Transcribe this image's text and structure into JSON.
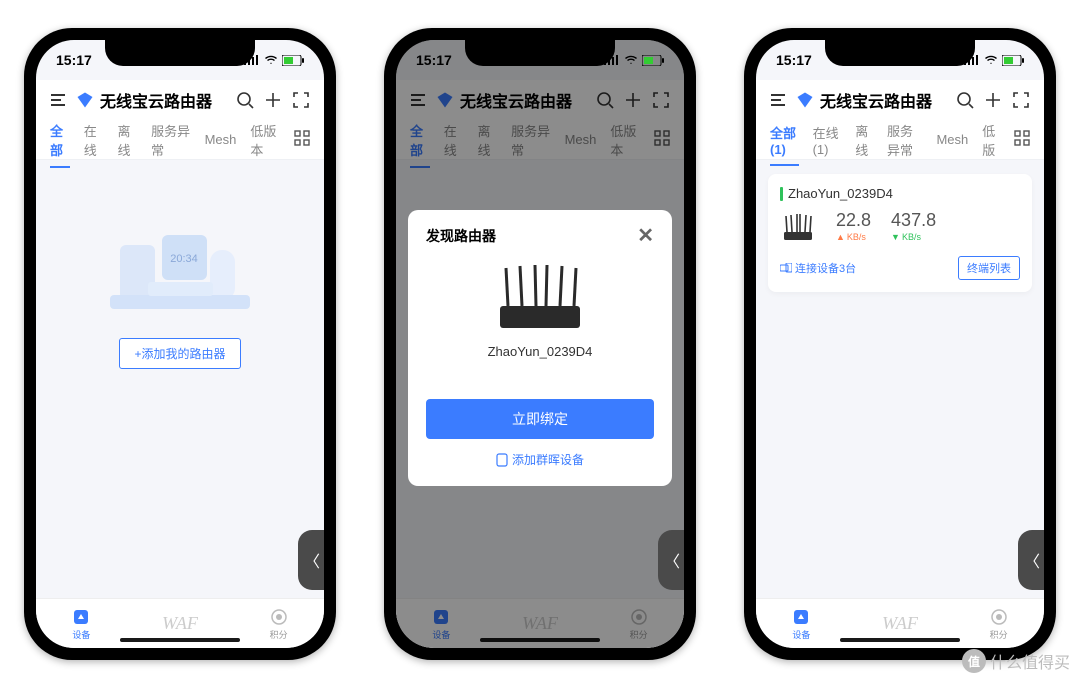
{
  "status": {
    "time": "15:17"
  },
  "header": {
    "title": "无线宝云路由器"
  },
  "tabs": {
    "s1": [
      "全部",
      "在线",
      "离线",
      "服务异常",
      "Mesh",
      "低版本"
    ],
    "s3": [
      "全部(1)",
      "在线(1)",
      "离线",
      "服务异常",
      "Mesh",
      "低版"
    ]
  },
  "empty": {
    "add_btn": "+添加我的路由器"
  },
  "modal": {
    "title": "发现路由器",
    "device": "ZhaoYun_0239D4",
    "bind": "立即绑定",
    "add_qunhui": "添加群晖设备"
  },
  "card": {
    "name": "ZhaoYun_0239D4",
    "up_val": "22.8",
    "up_unit": "KB/s",
    "dn_val": "437.8",
    "dn_unit": "KB/s",
    "conn": "连接设备3台",
    "term_btn": "终端列表"
  },
  "bottom": {
    "device": "设备",
    "points": "积分",
    "waf": "WAF"
  },
  "watermark": "什么值得买"
}
